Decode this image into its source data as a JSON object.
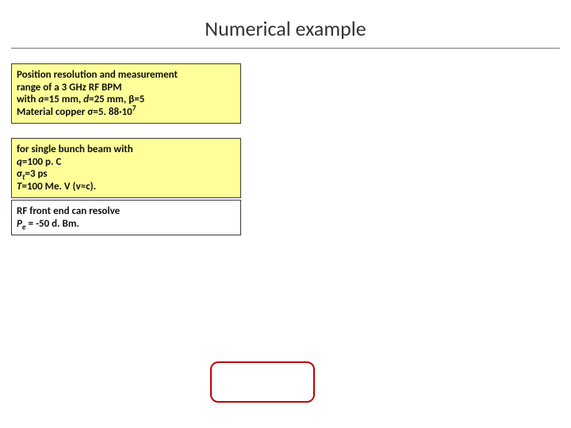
{
  "title": "Numerical example",
  "box1": {
    "l1a": "Position resolution and measurement",
    "l1b": "range of a ",
    "l1c": "3 GHz RF BPM",
    "l2a": "a",
    "l2b": "=15 mm, ",
    "l2c": "d",
    "l2d": "=25 mm, β=5",
    "l3a": "Material copper σ=",
    "l3b": "5. 88·10",
    "l3c": "7"
  },
  "box2": {
    "l1": "for single bunch beam with",
    "l2a": "q",
    "l2b": "=100 p. C",
    "l3a": "σ",
    "l3sub": "t",
    "l3b": "=3 ps",
    "l4a": "T",
    "l4b": "=100 Me. V (v≈c)."
  },
  "box3": {
    "l1": " RF front end can resolve",
    "l2a": "P",
    "l2sub": "e",
    "l2b": " = -50 d. Bm."
  }
}
